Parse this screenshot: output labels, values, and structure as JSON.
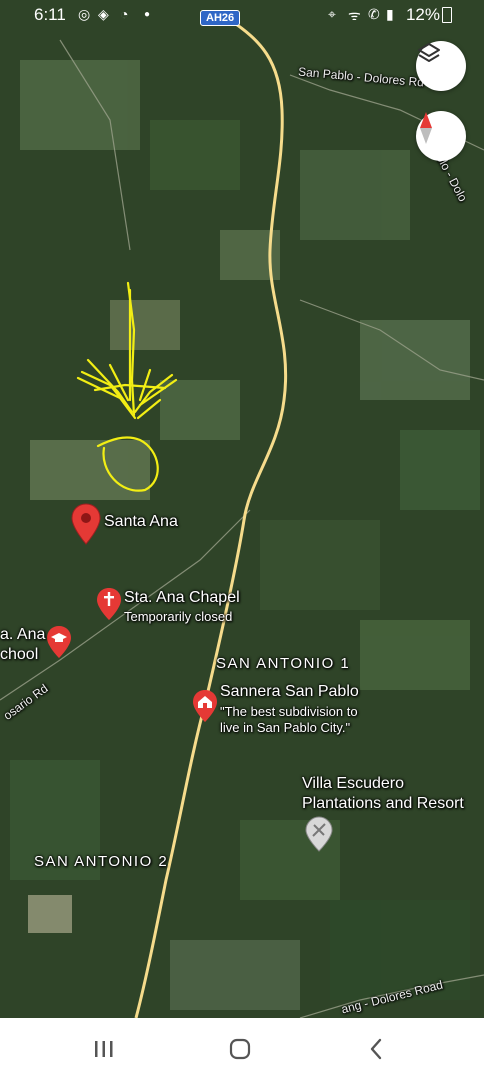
{
  "status_bar": {
    "time": "6:11",
    "battery": "12%",
    "icons": [
      "app-icon-1",
      "app-icon-2",
      "app-icon-3",
      "dot",
      "location-icon",
      "wifi-call-icon",
      "signal-icon",
      "battery-icon"
    ]
  },
  "map": {
    "route_shield": "AH26",
    "roads": {
      "north": "San Pablo - Dolores Rd",
      "east_edge": "blo - Dolo",
      "south": "ang - Dolores Road",
      "west": "osario Rd"
    },
    "places": {
      "santa_ana": "Santa Ana",
      "chapel_name": "Sta. Ana Chapel",
      "chapel_status": "Temporarily closed",
      "school_line1": "a. Ana",
      "school_line2": "chool",
      "sannera_name": "Sannera San Pablo",
      "sannera_desc1": "\"The best subdivision to",
      "sannera_desc2": "live in San Pablo City.\"",
      "villa_line1": "Villa Escudero",
      "villa_line2": "Plantations and Resort"
    },
    "areas": {
      "san_antonio_1": "SAN ANTONIO 1",
      "san_antonio_2": "SAN ANTONIO 2"
    },
    "colors": {
      "pin_red": "#e53935",
      "road_yellow": "#f6dc8c",
      "drawing_yellow": "#f2ee14"
    }
  },
  "buttons": {
    "layers": "layers-icon",
    "compass": "compass-icon"
  },
  "nav_bar": {
    "recents": "recents-icon",
    "home": "home-icon",
    "back": "back-icon"
  }
}
